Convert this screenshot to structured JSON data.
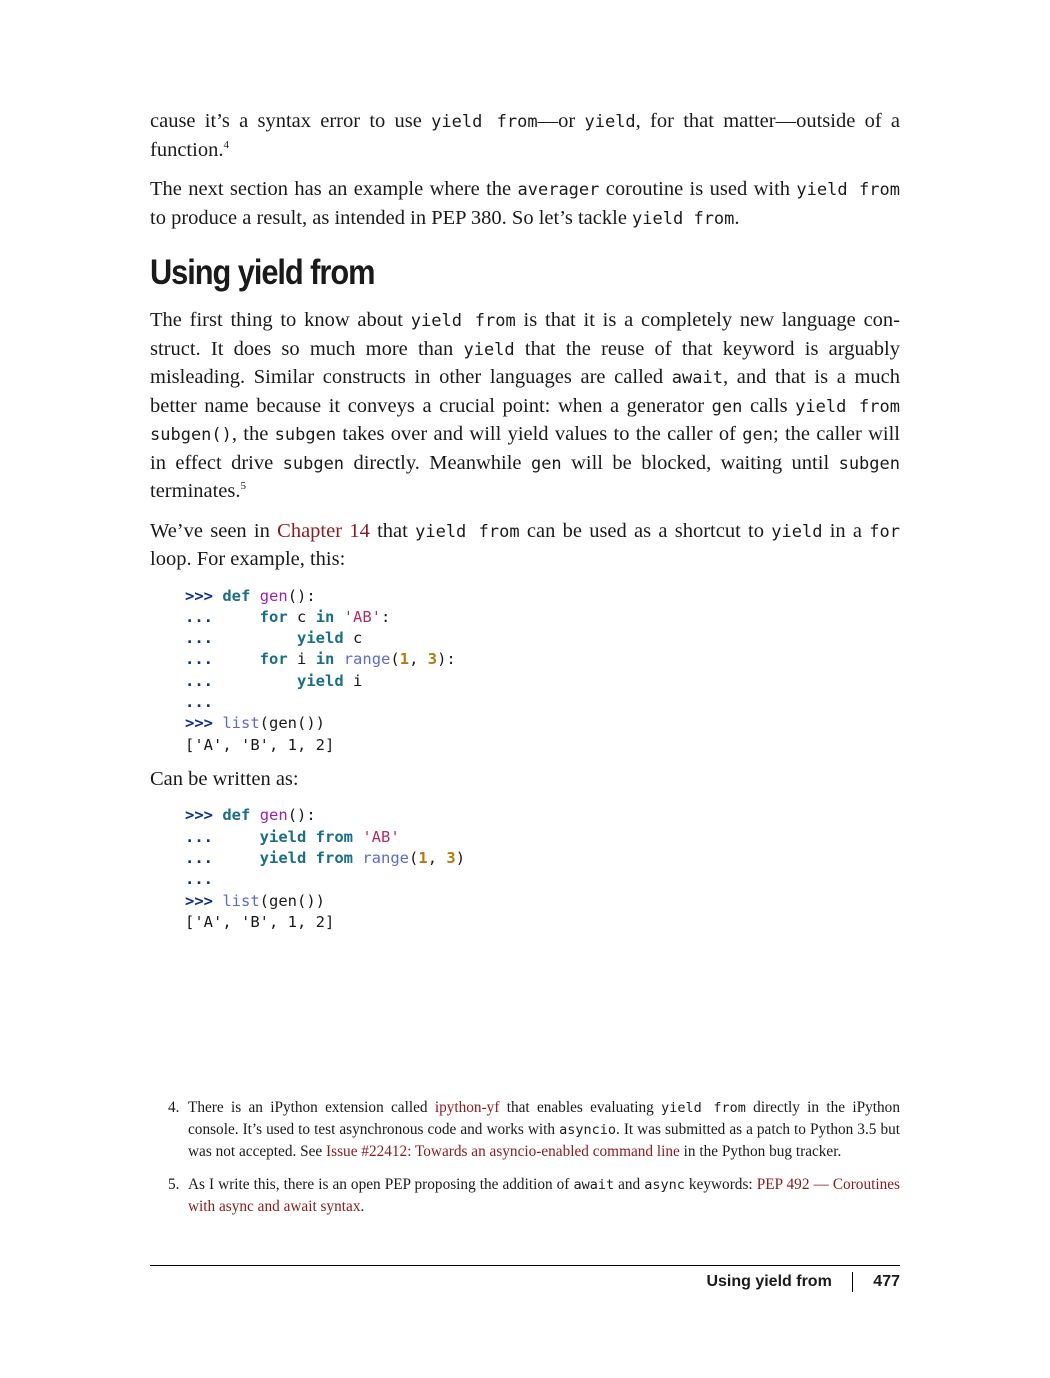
{
  "intro": {
    "p1": {
      "t1": "cause it’s a syntax error to use ",
      "c1": "yield from",
      "t2": "—or ",
      "c2": "yield",
      "t3": ", for that matter—outside of a function.",
      "sup": "4"
    },
    "p2": {
      "t1": "The next section has an example where the ",
      "c1": "averager",
      "t2": " coroutine is used with ",
      "c2": "yield from",
      "t3": " to produce a result, as intended in PEP 380. So let’s tackle ",
      "c3": "yield from",
      "t4": "."
    }
  },
  "section": {
    "title": "Using yield from",
    "p1": {
      "t1": "The first thing to know about ",
      "c1": "yield from",
      "t2": " is that it is a completely new language con­struct. It does so much more than ",
      "c2": "yield",
      "t3": " that the reuse of that keyword is arguably misleading. Similar constructs in other languages are called ",
      "c3": "await",
      "t4": ", and that is a much better name because it conveys a crucial point: when a generator ",
      "c4": "gen",
      "t5": " calls ",
      "c5": "yield from subgen()",
      "t6": ", the ",
      "c6": "subgen",
      "t7": " takes over and will yield values to the caller of ",
      "c7": "gen",
      "t8": "; the caller will in effect drive ",
      "c8": "subgen",
      "t9": " directly. Meanwhile ",
      "c9": "gen",
      "t10": " will be blocked, waiting until ",
      "c10": "subgen",
      "t11": " terminates.",
      "sup": "5"
    },
    "p2": {
      "t1": "We’ve seen in ",
      "link": "Chapter 14",
      "t2": " that ",
      "c1": "yield from",
      "t3": " can be used as a shortcut to ",
      "c2": "yield",
      "t4": " in a ",
      "c3": "for",
      "t5": " loop. For example, this:"
    },
    "p3": "Can be written as:"
  },
  "code1": {
    "prompt": ">>>",
    "cont": "...",
    "kw_def": "def",
    "fn_gen": "gen",
    "call_open": "():",
    "kw_for": "for",
    "var_c": "c",
    "kw_in": "in",
    "str_ab": "'AB'",
    "colon": ":",
    "kw_yield": "yield",
    "var_i": "i",
    "builtin_range": "range",
    "num_1": "1",
    "num_3": "3",
    "fn_list": "list",
    "output": "['A', 'B', 1, 2]"
  },
  "code2": {
    "kw_yield_from": "yield from"
  },
  "footnotes": {
    "fn4": {
      "num": "4.",
      "t1": "There is an iPython extension called ",
      "link1": "ipython-yf",
      "t2": " that enables evaluating ",
      "c1": "yield from",
      "t3": " directly in the iPython console. It’s used to test asynchronous code and works with ",
      "c2": "asyncio",
      "t4": ". It was submitted as a patch to Python 3.5 but was not accepted. See ",
      "link2": "Issue #22412: Towards an asyncio-enabled command line",
      "t5": " in the Python bug tracker."
    },
    "fn5": {
      "num": "5.",
      "t1": "As I write this, there is an open PEP proposing the addition of ",
      "c1": "await",
      "t2": " and ",
      "c2": "async",
      "t3": " keywords: ",
      "link1": "PEP 492 — Coroutines with async and await syntax",
      "t4": "."
    }
  },
  "footer": {
    "section": "Using yield from",
    "page": "477"
  }
}
